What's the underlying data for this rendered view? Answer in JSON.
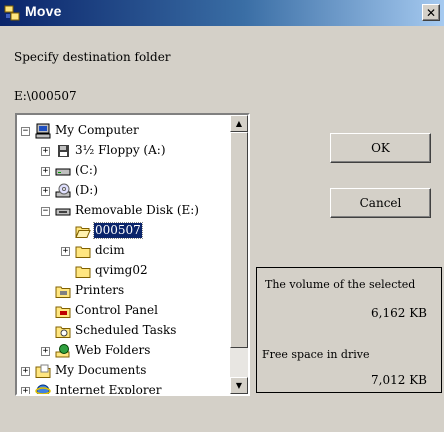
{
  "window": {
    "title": "Move",
    "close_glyph": "✕"
  },
  "dialog": {
    "instruction": "Specify destination folder",
    "path": "E:\\000507"
  },
  "tree": {
    "nodes": [
      {
        "label": "My Computer",
        "icon": "computer-icon",
        "expander": "−"
      },
      {
        "label": "3½ Floppy (A:)",
        "icon": "floppy-icon",
        "expander": "+"
      },
      {
        "label": "(C:)",
        "icon": "hard-drive-icon",
        "expander": "+"
      },
      {
        "label": "(D:)",
        "icon": "cd-drive-icon",
        "expander": "+"
      },
      {
        "label": "Removable Disk (E:)",
        "icon": "removable-disk-icon",
        "expander": "−"
      },
      {
        "label": "000507",
        "icon": "folder-open-icon",
        "selected": true
      },
      {
        "label": "dcim",
        "icon": "folder-icon",
        "expander": "+"
      },
      {
        "label": "qvimg02",
        "icon": "folder-icon"
      },
      {
        "label": "Printers",
        "icon": "printer-folder-icon"
      },
      {
        "label": "Control Panel",
        "icon": "control-panel-icon"
      },
      {
        "label": "Scheduled Tasks",
        "icon": "scheduled-tasks-icon"
      },
      {
        "label": "Web Folders",
        "icon": "web-folders-icon",
        "expander": "+"
      },
      {
        "label": "My Documents",
        "icon": "my-documents-icon",
        "expander": "+"
      },
      {
        "label": "Internet Explorer",
        "icon": "internet-explorer-icon",
        "expander": "+"
      }
    ],
    "scroll_up_glyph": "▲",
    "scroll_down_glyph": "▼"
  },
  "buttons": {
    "ok": "OK",
    "cancel": "Cancel"
  },
  "info": {
    "volume_label": "The volume of the selected",
    "volume_value": "6,162  KB",
    "free_label": "Free space in drive",
    "free_value": "7,012  KB"
  },
  "colors": {
    "titlebar_start": "#0a246a",
    "titlebar_end": "#a6caf0",
    "selection": "#0a246a",
    "face": "#d4d0c8"
  }
}
